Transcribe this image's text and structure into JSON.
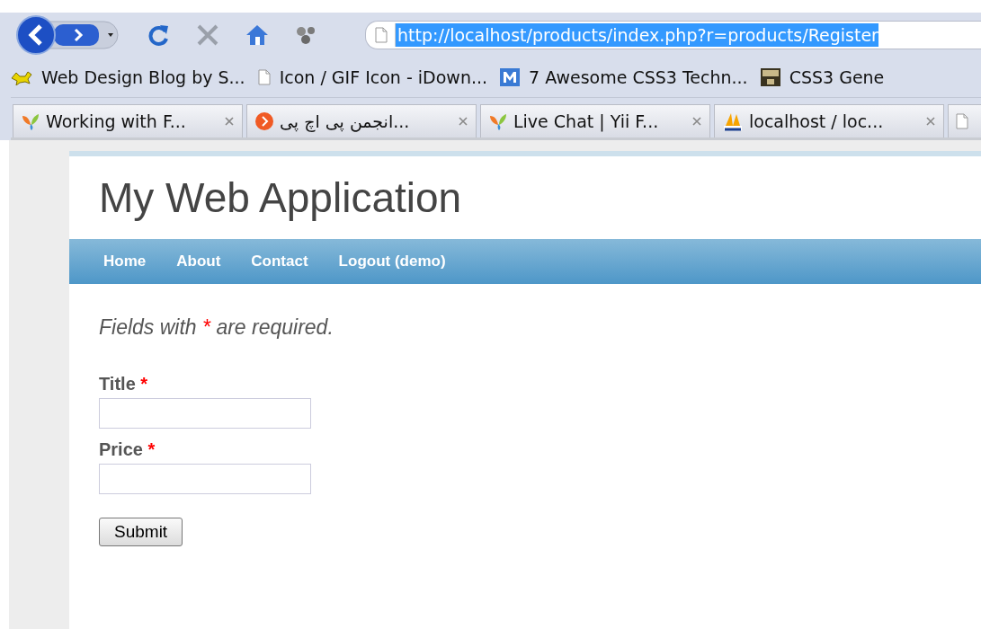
{
  "browser": {
    "address": {
      "url": "http://localhost/products/index.php?r=products/Register",
      "selected": true
    },
    "bookmarks": [
      "Web Design Blog by S...",
      "Icon / GIF Icon - iDown...",
      "7 Awesome CSS3 Techn...",
      "CSS3 Gene"
    ],
    "tabs": [
      "Working with F...",
      "انجمن پی اچ پی...",
      "Live Chat | Yii F...",
      "localhost / loc..."
    ]
  },
  "site": {
    "title": "My Web Application",
    "menu": [
      "Home",
      "About",
      "Contact",
      "Logout (demo)"
    ],
    "note": {
      "before": "Fields with",
      "mark": "*",
      "after": "are required."
    },
    "fields": [
      {
        "label": "Title",
        "required_mark": "*"
      },
      {
        "label": "Price",
        "required_mark": "*"
      }
    ],
    "submit": "Submit"
  }
}
